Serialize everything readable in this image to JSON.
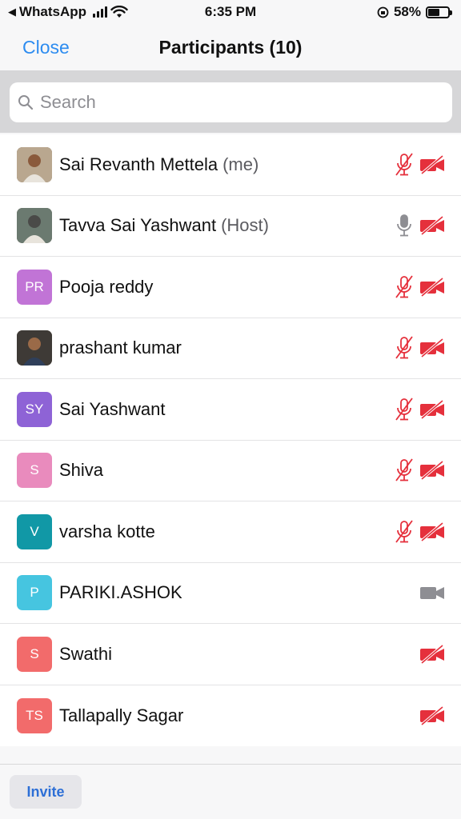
{
  "status_bar": {
    "back_app": "WhatsApp",
    "time": "6:35 PM",
    "battery": "58%",
    "battery_level": 0.58
  },
  "nav": {
    "close": "Close",
    "title": "Participants (10)"
  },
  "search": {
    "placeholder": "Search",
    "icon": "search-icon"
  },
  "participants": [
    {
      "name": "Sai Revanth Mettela",
      "role": "(me)",
      "avatar": "photo",
      "mic": "muted",
      "camera": "off"
    },
    {
      "name": "Tavva Sai Yashwant",
      "role": "(Host)",
      "avatar": "photo",
      "mic": "on",
      "camera": "off"
    },
    {
      "name": "Pooja reddy",
      "role": "",
      "avatar": "PR",
      "avatar_color": "#c174d6",
      "mic": "muted",
      "camera": "off"
    },
    {
      "name": "prashant kumar",
      "role": "",
      "avatar": "photo",
      "mic": "muted",
      "camera": "off"
    },
    {
      "name": "Sai Yashwant",
      "role": "",
      "avatar": "SY",
      "avatar_color": "#8e63d6",
      "mic": "muted",
      "camera": "off"
    },
    {
      "name": "Shiva",
      "role": "",
      "avatar": "S",
      "avatar_color": "#e98bbd",
      "mic": "muted",
      "camera": "off"
    },
    {
      "name": "varsha kotte",
      "role": "",
      "avatar": "V",
      "avatar_color": "#1198a6",
      "mic": "muted",
      "camera": "off"
    },
    {
      "name": "PARIKI.ASHOK",
      "role": "",
      "avatar": "P",
      "avatar_color": "#46c5e0",
      "mic": "none",
      "camera": "on"
    },
    {
      "name": "Swathi",
      "role": "",
      "avatar": "S",
      "avatar_color": "#f26b6b",
      "mic": "none",
      "camera": "off"
    },
    {
      "name": "Tallapally Sagar",
      "role": "",
      "avatar": "TS",
      "avatar_color": "#f26b6b",
      "mic": "none",
      "camera": "off"
    }
  ],
  "footer": {
    "invite": "Invite"
  },
  "colors": {
    "accent": "#2d8cf0",
    "muted_red": "#e5303c",
    "neutral_gray": "#8e8e93"
  }
}
